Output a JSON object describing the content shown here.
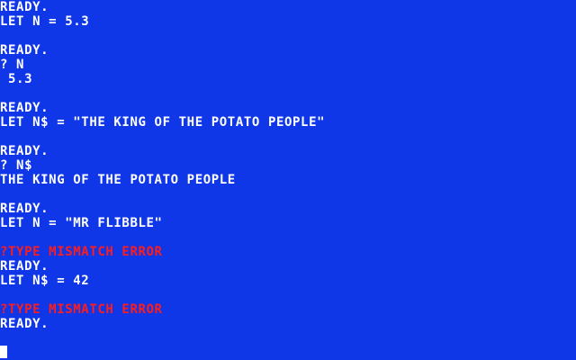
{
  "terminal": {
    "lines": [
      {
        "text": "READY.",
        "kind": "prompt"
      },
      {
        "text": "LET N = 5.3",
        "kind": "input"
      },
      {
        "text": "",
        "kind": "blank"
      },
      {
        "text": "READY.",
        "kind": "prompt"
      },
      {
        "text": "? N",
        "kind": "input"
      },
      {
        "text": " 5.3",
        "kind": "output"
      },
      {
        "text": "",
        "kind": "blank"
      },
      {
        "text": "READY.",
        "kind": "prompt"
      },
      {
        "text": "LET N$ = \"THE KING OF THE POTATO PEOPLE\"",
        "kind": "input"
      },
      {
        "text": "",
        "kind": "blank"
      },
      {
        "text": "READY.",
        "kind": "prompt"
      },
      {
        "text": "? N$",
        "kind": "input"
      },
      {
        "text": "THE KING OF THE POTATO PEOPLE",
        "kind": "output"
      },
      {
        "text": "",
        "kind": "blank"
      },
      {
        "text": "READY.",
        "kind": "prompt"
      },
      {
        "text": "LET N = \"MR FLIBBLE\"",
        "kind": "input"
      },
      {
        "text": "",
        "kind": "blank"
      },
      {
        "text": "?TYPE MISMATCH ERROR",
        "kind": "error"
      },
      {
        "text": "READY.",
        "kind": "prompt"
      },
      {
        "text": "LET N$ = 42",
        "kind": "input"
      },
      {
        "text": "",
        "kind": "blank"
      },
      {
        "text": "?TYPE MISMATCH ERROR",
        "kind": "error"
      },
      {
        "text": "READY.",
        "kind": "prompt"
      }
    ]
  },
  "colors": {
    "background": "#0f37e8",
    "text": "#ffffff",
    "error": "#ff1c1c",
    "cursor": "#ffffff"
  }
}
